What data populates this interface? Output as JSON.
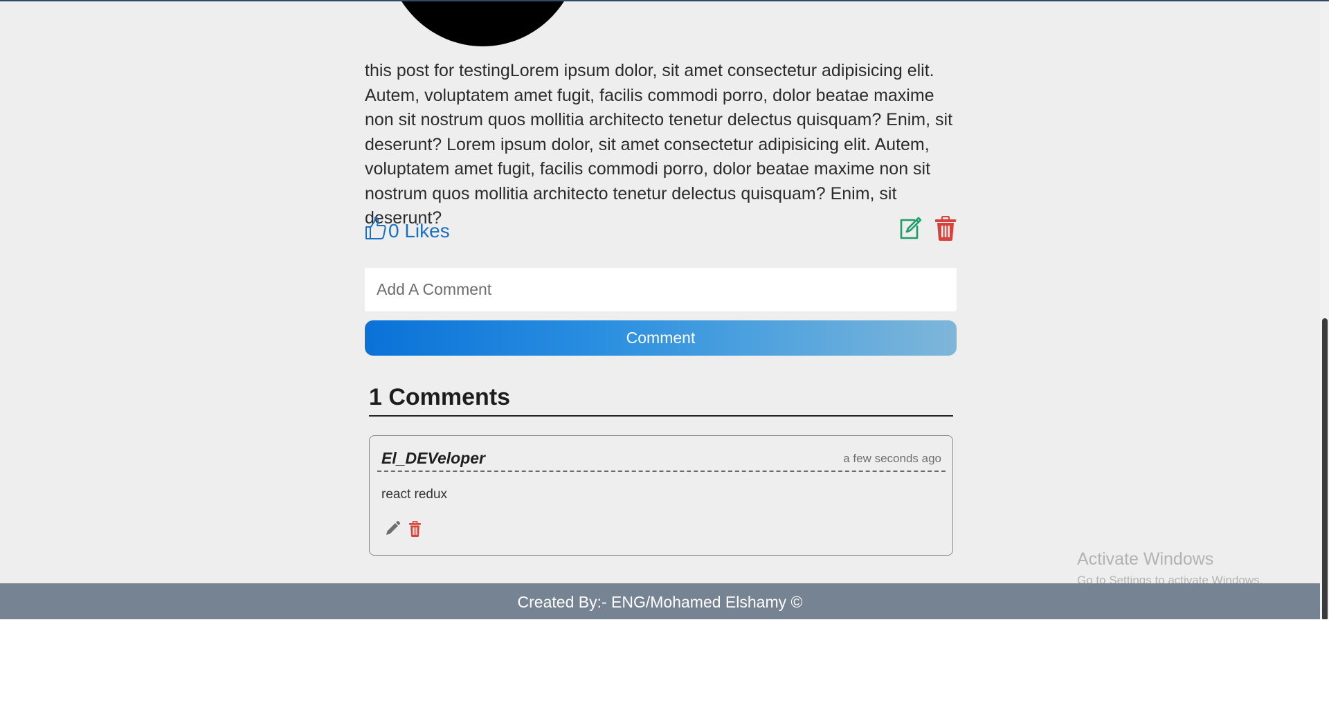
{
  "post": {
    "body": "this post for testingLorem ipsum dolor, sit amet consectetur adipisicing elit. Autem, voluptatem amet fugit, facilis commodi porro, dolor beatae maxime non sit nostrum quos mollitia architecto tenetur delectus quisquam? Enim, sit deserunt? Lorem ipsum dolor, sit amet consectetur adipisicing elit. Autem, voluptatem amet fugit, facilis commodi porro, dolor beatae maxime non sit nostrum quos mollitia architecto tenetur delectus quisquam? Enim, sit deserunt?",
    "likes_label": "0 Likes",
    "like_icon": "thumbs-up-icon",
    "edit_icon": "edit-icon",
    "delete_icon": "trash-icon"
  },
  "comment_form": {
    "placeholder": "Add A Comment",
    "button_label": "Comment"
  },
  "comments": {
    "title": "1 Comments",
    "items": [
      {
        "user": "El_DEVeloper",
        "time": "a few seconds ago",
        "text": "react redux",
        "edit_icon": "pencil-icon",
        "delete_icon": "trash-icon"
      }
    ]
  },
  "footer": {
    "text": "Created By:- ENG/Mohamed Elshamy ©"
  },
  "watermark": {
    "title": "Activate Windows",
    "subtitle": "Go to Settings to activate Windows."
  },
  "colors": {
    "like_blue": "#1a6fc2",
    "edit_green": "#1b9e6a",
    "delete_red": "#d9423b",
    "footer_bg": "#768393"
  }
}
